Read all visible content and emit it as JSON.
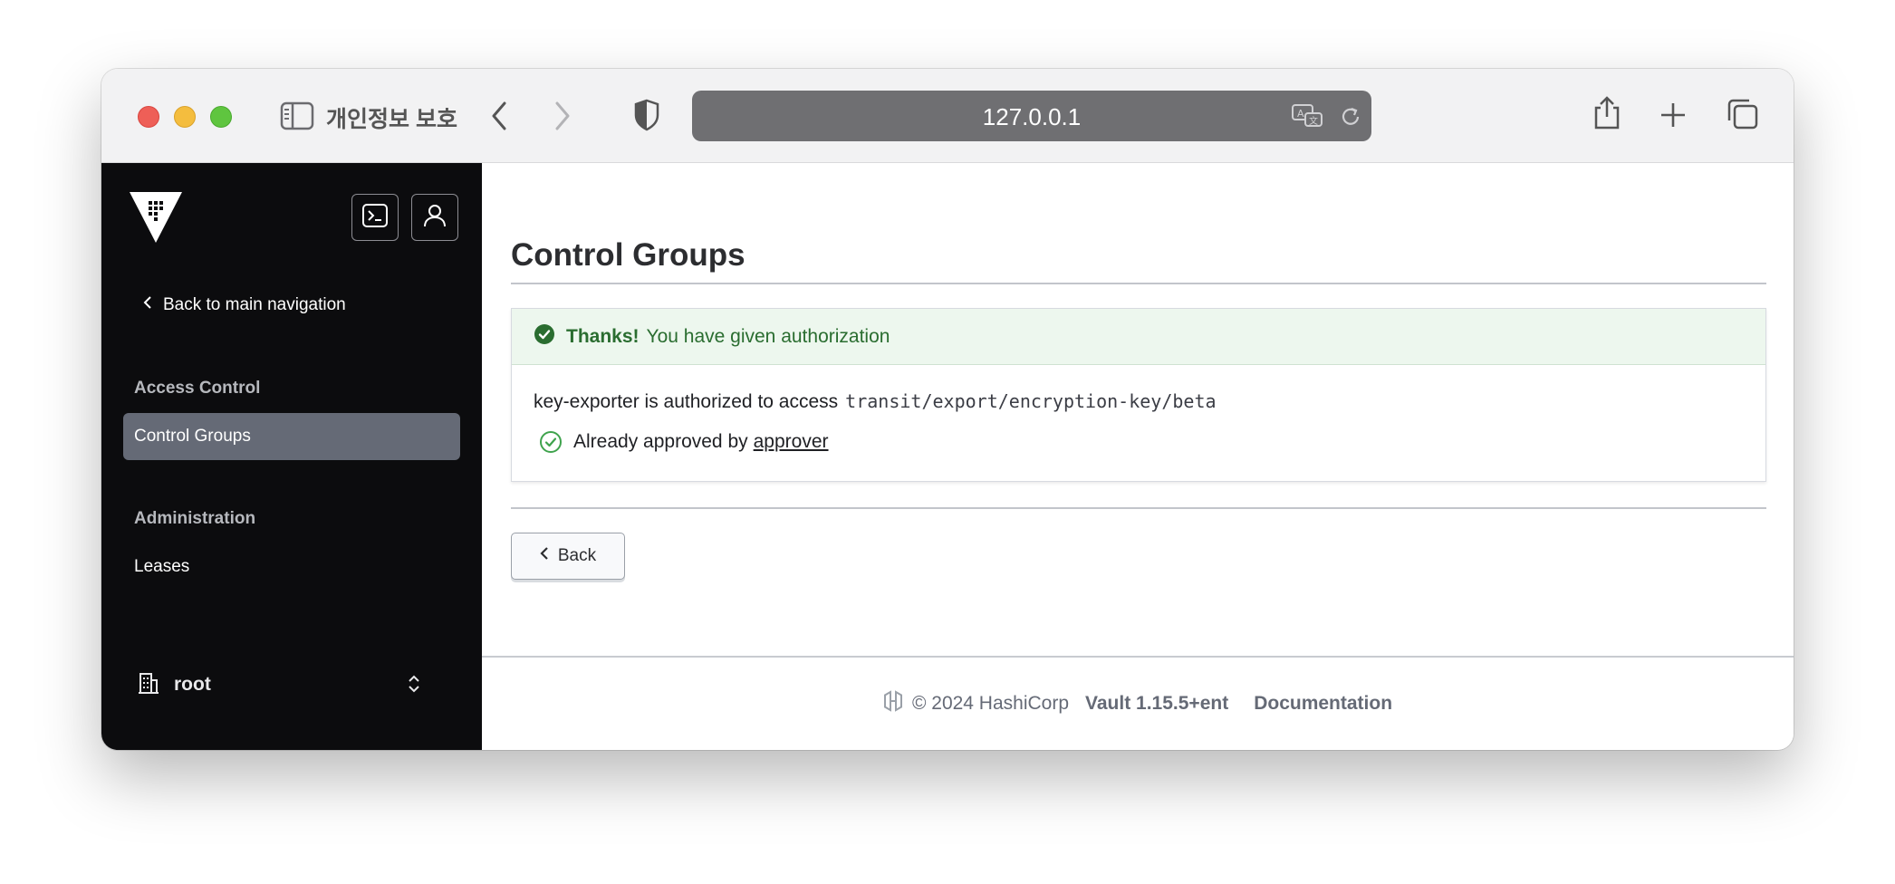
{
  "browser": {
    "sidebar_label": "개인정보 보호",
    "url": "127.0.0.1"
  },
  "sidebar": {
    "back_label": "Back to main navigation",
    "sections": [
      {
        "label": "Access Control",
        "items": [
          {
            "label": "Control Groups",
            "active": true
          }
        ]
      },
      {
        "label": "Administration",
        "items": [
          {
            "label": "Leases",
            "active": false
          }
        ]
      }
    ],
    "namespace": "root"
  },
  "main": {
    "title": "Control Groups",
    "alert": {
      "strong": "Thanks!",
      "text": "You have given authorization"
    },
    "authorized_text": "key-exporter is authorized to access",
    "path": "transit/export/encryption-key/beta",
    "approved_text": "Already approved by",
    "approver": "approver",
    "back_button": "Back"
  },
  "footer": {
    "copyright": "© 2024 HashiCorp",
    "version": "Vault 1.15.5+ent",
    "documentation": "Documentation"
  },
  "colors": {
    "sidebar_bg": "#0c0c0e",
    "active_item": "#656a76",
    "success_green": "#2a6d30",
    "alert_bg": "#edf7ee"
  }
}
